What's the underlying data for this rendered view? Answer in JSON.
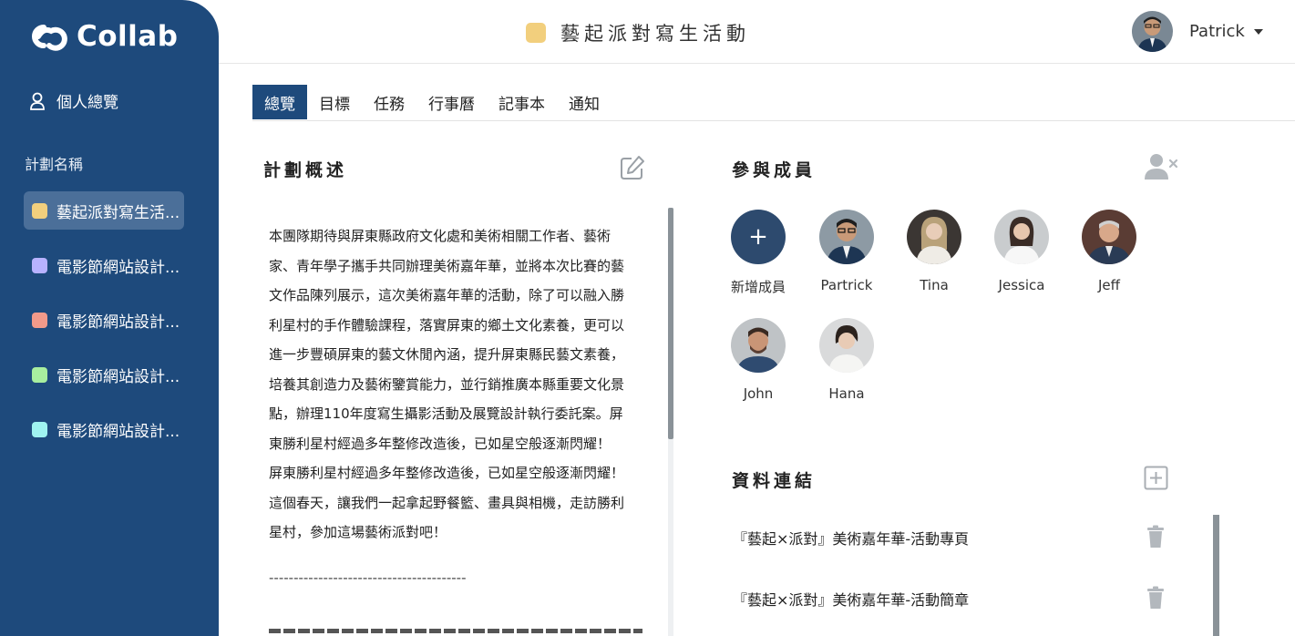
{
  "app": {
    "name": "Collab"
  },
  "sidebar": {
    "personal_label": "個人總覽",
    "section_label": "計劃名稱",
    "projects": [
      {
        "label": "藝起派對寫生活...",
        "color": "#f2cf7d",
        "active": true
      },
      {
        "label": "電影節網站設計...",
        "color": "#b8b2ff",
        "active": false
      },
      {
        "label": "電影節網站設計...",
        "color": "#f29a8a",
        "active": false
      },
      {
        "label": "電影節網站設計...",
        "color": "#a8ee9f",
        "active": false
      },
      {
        "label": "電影節網站設計...",
        "color": "#9ff3f0",
        "active": false
      }
    ]
  },
  "header": {
    "title": "藝起派對寫生活動",
    "title_color": "#f2cf7d",
    "user_name": "Patrick"
  },
  "tabs": [
    "總覽",
    "目標",
    "任務",
    "行事曆",
    "記事本",
    "通知"
  ],
  "overview": {
    "title": "計劃概述",
    "lines": [
      "本團隊期待與屏東縣政府文化處和美術相關工作者、藝術",
      "家、青年學子攜手共同辦理美術嘉年華，並將本次比賽的藝",
      "文作品陳列展示，這次美術嘉年華的活動，除了可以融入勝",
      "利星村的手作體驗課程，落實屏東的鄉土文化素養，更可以",
      "進一步豐碩屏東的藝文休閒內涵，提升屏東縣民藝文素養，",
      "培養其創造力及藝術鑒賞能力，並行銷推廣本縣重要文化景",
      "點，辦理110年度寫生攝影活動及展覽設計執行委託案。屏",
      "東勝利星村經過多年整修改造後，已如星空般逐漸閃耀！",
      "屏東勝利星村經過多年整修改造後，已如星空般逐漸閃耀！",
      "這個春天，讓我們一起拿起野餐籃、畫具與相機，走訪勝利",
      "星村，參加這場藝術派對吧！"
    ],
    "divider": "----------------------------------------"
  },
  "members": {
    "title": "參與成員",
    "add_label": "新增成員",
    "list": [
      {
        "name": "Partrick"
      },
      {
        "name": "Tina"
      },
      {
        "name": "Jessica"
      },
      {
        "name": "Jeff"
      },
      {
        "name": "John"
      },
      {
        "name": "Hana"
      }
    ]
  },
  "links": {
    "title": "資料連結",
    "items": [
      {
        "label": "『藝起×派對』美術嘉年華-活動專頁"
      },
      {
        "label": "『藝起×派對』美術嘉年華-活動簡章"
      }
    ]
  },
  "colors": {
    "sidebar": "#1e4a7c",
    "active_tab": "#1e4a7c",
    "add_member": "#2d4a6e"
  },
  "icons": [
    "collab-logo-icon",
    "user-icon",
    "edit-icon",
    "remove-user-icon",
    "add-box-icon",
    "trash-icon"
  ]
}
